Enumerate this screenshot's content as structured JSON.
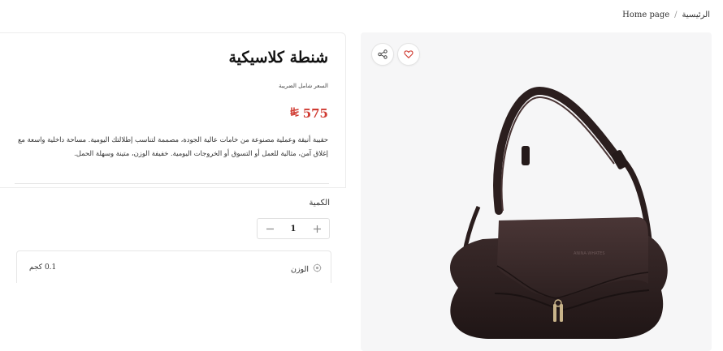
{
  "breadcrumb": {
    "home": "الرئيسية",
    "separator": "/",
    "current": "Home page"
  },
  "product": {
    "title": "شنطة كلاسيكية",
    "tax_note": "السعر شامل الضريبة",
    "price": "575",
    "currency_symbol": "⃁",
    "price_color": "#d03b32",
    "description": "حقيبة أنيقة وعملية مصنوعة من خامات عالية الجودة، مصممة لتناسب إطلالتك اليومية. مساحة داخلية واسعة مع إغلاق آمن، مثالية للعمل أو التسوق أو الخروجات اليومية. خفيفة الوزن، متينة وسهلة الحمل.",
    "quantity_label": "الكمية",
    "quantity": "1",
    "weight_label": "الوزن",
    "weight_value": "0.1 كجم"
  },
  "icons": {
    "share": "share-icon",
    "favorite": "heart-icon",
    "weight": "weight-icon",
    "minus": "minus-icon",
    "plus": "plus-icon"
  },
  "colors": {
    "accent": "#d03b32",
    "gallery_bg": "#f6f6f7"
  }
}
